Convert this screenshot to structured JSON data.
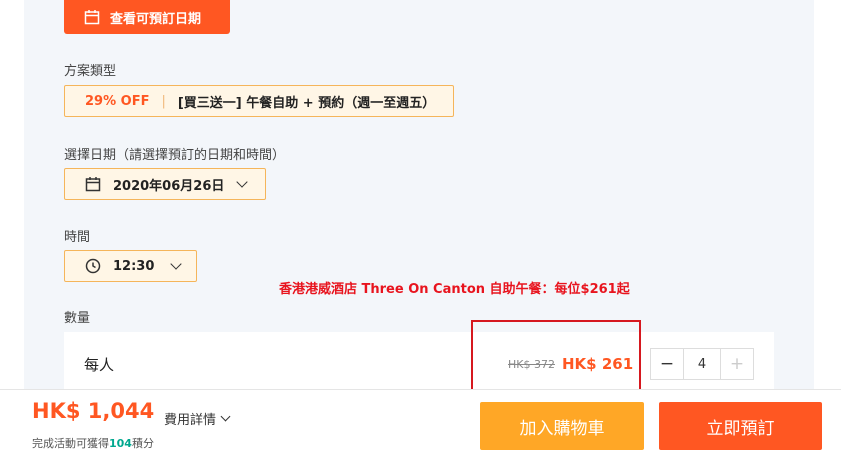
{
  "check_dates_button": "查看可預訂日期",
  "package": {
    "label": "方案類型",
    "discount": "29% OFF",
    "separator": "|",
    "name": "[買三送一] 午餐自助 + 預約（週一至週五）"
  },
  "date": {
    "label": "選擇日期（請選擇預訂的日期和時間）",
    "value": "2020年06月26日"
  },
  "time": {
    "label": "時間",
    "value": "12:30"
  },
  "promo_text": "香港港威酒店 Three On Canton 自助午餐：每位$261起",
  "quantity": {
    "label": "數量",
    "unit": "每人",
    "original_price": "HK$ 372",
    "price": "HK$ 261",
    "minus": "−",
    "value": "4",
    "plus": "+"
  },
  "footer": {
    "total": "HK$ 1,044",
    "fee_details": "費用詳情",
    "points_prefix": "完成活動可獲得",
    "points_value": "104",
    "points_suffix": "積分",
    "add_to_cart": "加入購物車",
    "book_now": "立即預訂"
  },
  "colors": {
    "accent": "#ff5722",
    "cart": "#ffa726",
    "promo": "#e8141e",
    "points": "#00a88f"
  }
}
